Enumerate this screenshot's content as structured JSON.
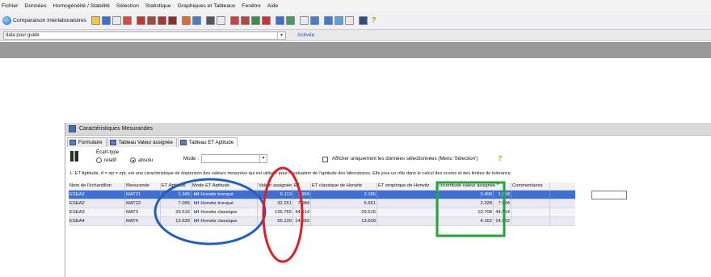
{
  "menu": [
    "Fichier",
    "Données",
    "Homogénéité / Stabilité",
    "Sélection",
    "Statistique",
    "Graphiques et Tableaux",
    "Fenêtre",
    "Aide"
  ],
  "toolbar": {
    "app_title": "Comparaison interlaboratoires",
    "help_label": "?"
  },
  "guide": {
    "select_value": "data pour guide",
    "active_label": "Activée"
  },
  "window": {
    "title": "Caractéristiques Mesurandes",
    "tabs": [
      "Formulaire",
      "Tableau Valeur assignée",
      "Tableau ET Aptitude"
    ],
    "ecart_type_label": "Écart-type",
    "radio_relatif": "relatif",
    "radio_absolu": "absolu",
    "mode_label": "Mode :",
    "checkbox_label": "Afficher uniquement les données sélectionnées (Menu 'Sélection')",
    "info_text": "L' ET Aptitude,  σ̂ = σp = σpt, est une caractéristique de dispersion des valeurs mesurées qui est utilisée pour l'évaluation de l'aptitude des laboratoires. Elle joue un rôle dans le calcul des scores et des limites de tolérance."
  },
  "table": {
    "headers": [
      "Nom de l'échantillon",
      "Mesurande",
      "ET Aptitude",
      "Mode ET Aptitude",
      "Valeur assignée",
      "ET",
      "ET classique de Horwitz",
      "ET empirique de Horwitz",
      "Incertitude valeur assignée *",
      "Commentaires"
    ],
    "rows": [
      {
        "ech": "ESEA2",
        "mes": "MAT21",
        "apt": "1.345",
        "mode": "Horwitz tronqué",
        "va": "6.113",
        "et": "1.958",
        "cl": "2.186",
        "emp": "",
        "inc": "0.408",
        "inc_et": "1.958"
      },
      {
        "ech": "ESEA2",
        "mes": "MAT22",
        "apt": "7.095",
        "mode": "Horwitz tronqué",
        "va": "32.251",
        "et": "7.984",
        "cl": "6.651",
        "emp": "",
        "inc": "2.328",
        "inc_et": "7.984"
      },
      {
        "ech": "ESEA3",
        "mes": "MAT3",
        "apt": "29.516",
        "mode": "Horwitz classique",
        "va": "136.765",
        "et": "44.514",
        "cl": "29.516",
        "emp": "",
        "inc": "10.708",
        "inc_et": "44.514"
      },
      {
        "ech": "ESEA4",
        "mes": "MAT4",
        "apt": "13.639",
        "mode": "Horwitz classique",
        "va": "55.120",
        "et": "14.582",
        "cl": "13.639",
        "emp": "",
        "inc": "4.162",
        "inc_et": "14.582"
      }
    ]
  },
  "colors": {
    "selected_row": "#3d6fd6",
    "blue_annotation": "#1f5fbf",
    "red_annotation": "#e02020",
    "green_annotation": "#22a63a"
  }
}
